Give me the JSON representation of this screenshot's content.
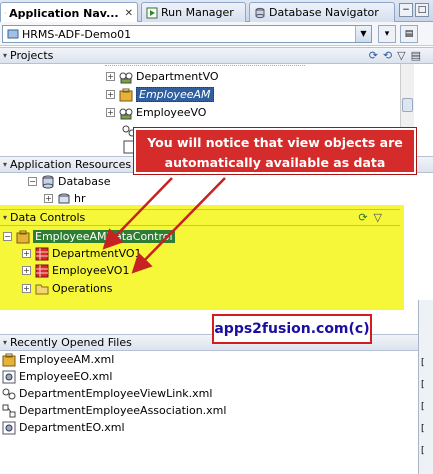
{
  "tabs": [
    {
      "label": "Application Nav...",
      "active": true
    },
    {
      "label": "Run Manager",
      "active": false
    },
    {
      "label": "Database Navigator",
      "active": false
    }
  ],
  "project_combo": {
    "value": "HRMS-ADF-Demo01"
  },
  "projects": {
    "title": "Projects",
    "items": [
      {
        "label": "DepartmentVO"
      },
      {
        "label": "EmployeeAM",
        "selected": true
      },
      {
        "label": "EmployeeVO"
      }
    ]
  },
  "app_resources": {
    "title": "Application Resources",
    "items": [
      {
        "label": "Database"
      },
      {
        "label": "hr"
      }
    ]
  },
  "data_controls": {
    "title": "Data Controls",
    "root": "EmployeeAMDataControl",
    "items": [
      {
        "label": "DepartmentVO1"
      },
      {
        "label": "EmployeeVO1"
      },
      {
        "label": "Operations"
      }
    ]
  },
  "callout_main": "You will notice that view objects are automatically available as data controls",
  "callout_brand": "apps2fusion.com(c)",
  "recent_files": {
    "title": "Recently Opened Files",
    "items": [
      {
        "label": "EmployeeAM.xml"
      },
      {
        "label": "EmployeeEO.xml"
      },
      {
        "label": "DepartmentEmployeeViewLink.xml"
      },
      {
        "label": "DepartmentEmployeeAssociation.xml"
      },
      {
        "label": "DepartmentEO.xml"
      }
    ]
  },
  "colors": {
    "highlight": "#f7f73a",
    "callout": "#d52b2b",
    "selection": "#2f5f9e"
  }
}
